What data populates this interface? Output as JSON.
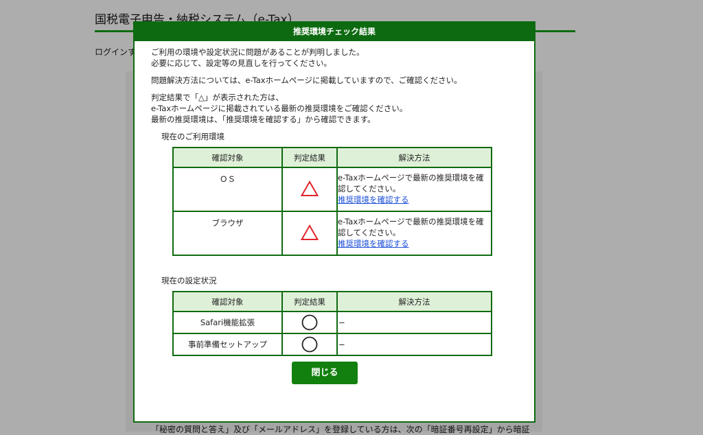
{
  "background": {
    "site_title": "国税電子申告・納税システム（e-Tax）",
    "login_text": "ログインす",
    "bottom_text": "「秘密の質問と答え」及び「メールアドレス」を登録している方は、次の「暗証番号再設定」から暗証"
  },
  "modal": {
    "title": "推奨環境チェック結果",
    "intro": [
      "ご利用の環境や設定状況に問題があることが判明しました。",
      "必要に応じて、設定等の見直しを行ってください。"
    ],
    "solution_note": "問題解決方法については、e-Taxホームページに掲載していますので、ご確認ください。",
    "triangle_note": [
      "判定結果で「△」が表示された方は、",
      "e-Taxホームページに掲載されている最新の推奨環境をご確認ください。",
      "最新の推奨環境は、「推奨環境を確認する」から確認できます。"
    ],
    "env_section_title": "現在のご利用環境",
    "settings_section_title": "現在の設定状況",
    "columns": {
      "target": "確認対象",
      "result": "判定結果",
      "fix": "解決方法"
    },
    "env_rows": [
      {
        "target": "ＯＳ",
        "result_icon": "warning-triangle",
        "fix_lines": [
          "e-Taxホームページで最新の推奨環境を確",
          "認してください。"
        ],
        "link": "推奨環境を確認する"
      },
      {
        "target": "ブラウザ",
        "result_icon": "warning-triangle",
        "fix_lines": [
          "e-Taxホームページで最新の推奨環境を確",
          "認してください。"
        ],
        "link": "推奨環境を確認する"
      }
    ],
    "settings_rows": [
      {
        "target": "Safari機能拡張",
        "result_icon": "ok-circle",
        "fix": "−"
      },
      {
        "target": "事前準備セットアップ",
        "result_icon": "ok-circle",
        "fix": "−"
      }
    ],
    "close_label": "閉じる"
  },
  "colors": {
    "brand_green": "#0d6a10",
    "button_green": "#12800f",
    "header_cell_bg": "#dff0d8",
    "warning_red": "#e0242a",
    "link_blue": "#1a4ed8"
  }
}
